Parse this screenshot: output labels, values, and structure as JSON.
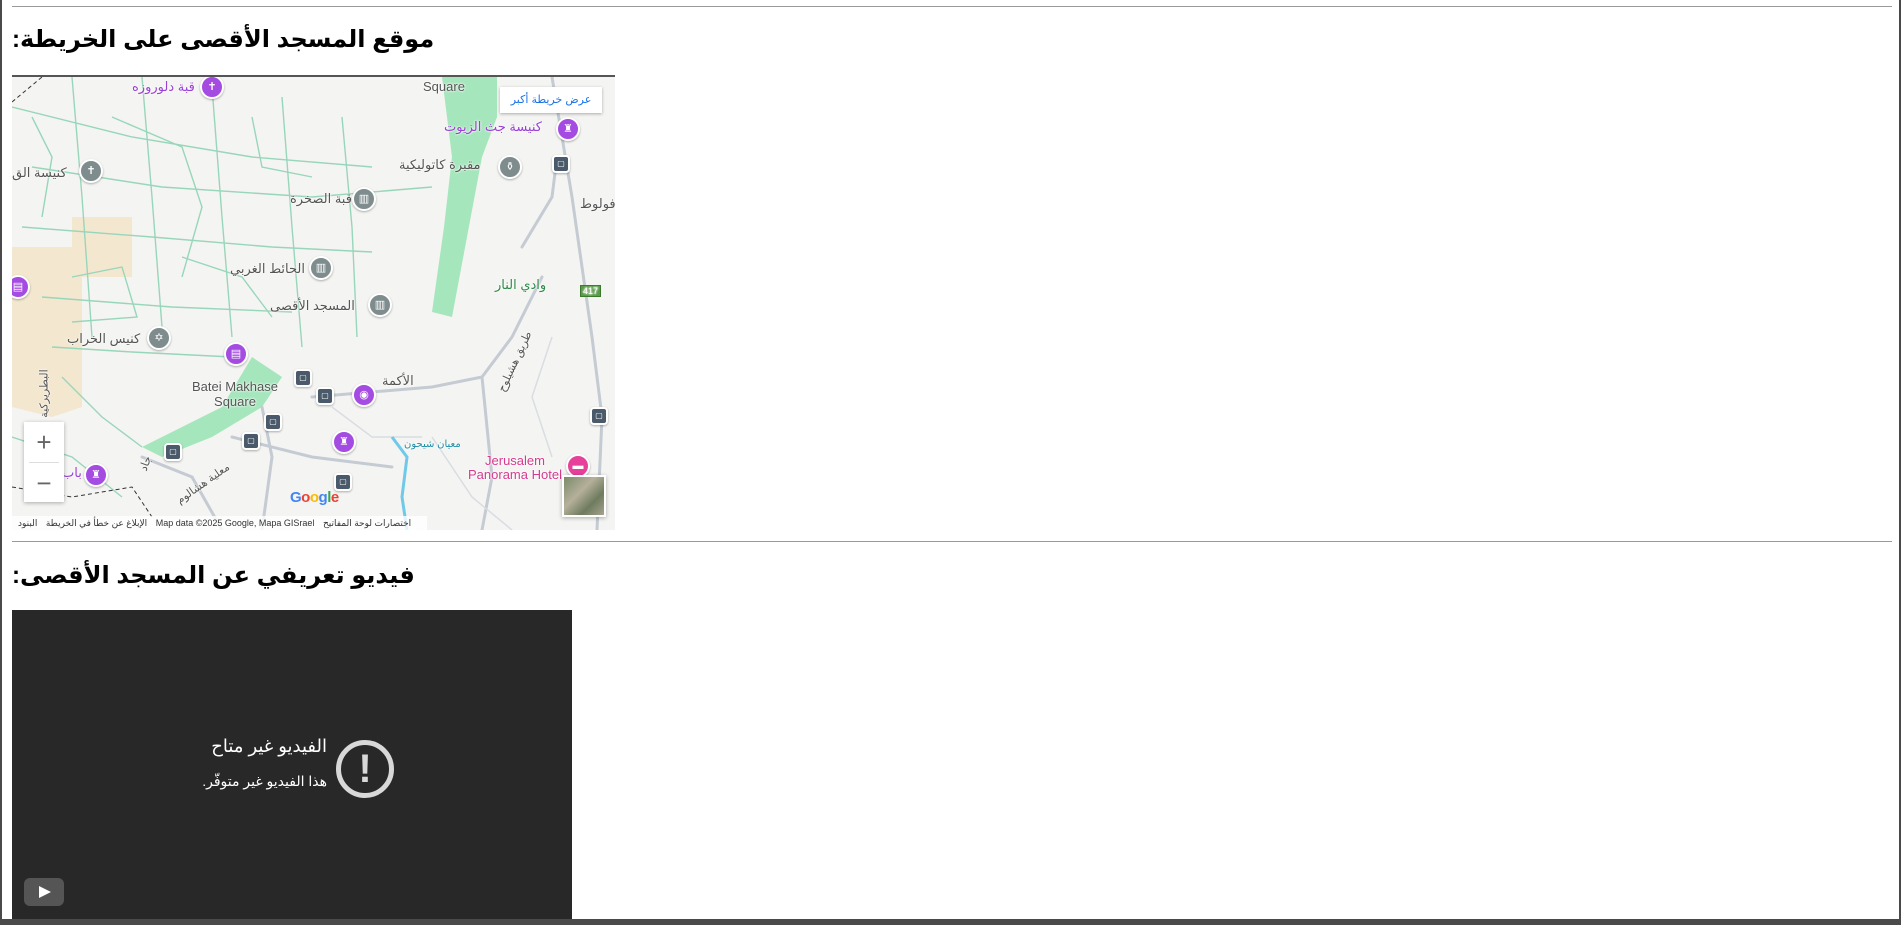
{
  "map_section": {
    "heading": "موقع المسجد الأقصى على الخريطة:",
    "larger_map": "عرض خريطة أكبر",
    "zoom_in": "+",
    "zoom_out": "−",
    "footer": {
      "shortcuts": "اختصارات لوحة المفاتيح",
      "data": "Map data ©2025 Google, Mapa GISrael",
      "terms": "البنود",
      "report": "الإبلاغ عن خطأ في الخريطة"
    },
    "google_logo": "Google",
    "labels": {
      "square": "Square",
      "gethsemane": "كنيسة جث الزيوت",
      "catholic_tomb": "مقبرة كاتوليكية",
      "dome_rock": "قبة الصخرة",
      "western_wall": "الحائط الغربي",
      "aqsa": "المسجد الأقصى",
      "hurva": "كنيس الخراب",
      "batei": "Batei Makhase Square",
      "akma": "الأكمة",
      "wadi": "وادي النار",
      "church_q": "كنيسة الق",
      "dolorosa": "قبة دلوروزه",
      "jerusalem_hotel": "Jerusalem Panorama Hotel",
      "route": "417",
      "foloot": "س فولوط",
      "maale": "معلية هشالوم",
      "hstreet": "طريق هشيلوح",
      "bab": "باب",
      "patriarch": "البطريركية",
      "ascent": "معيان شيحون",
      "jad": "جاد"
    }
  },
  "video_section": {
    "heading": "فيديو تعريفي عن المسجد الأقصى:",
    "title": "الفيديو غير متاح",
    "subtitle": "هذا الفيديو غير متوفّر."
  },
  "colors": {
    "map_bg": "#f4f4f2",
    "park_green": "#7fd9a0",
    "street_green": "#9ad6bc",
    "video_bg": "#282828",
    "poi_purple": "#a44be2"
  }
}
